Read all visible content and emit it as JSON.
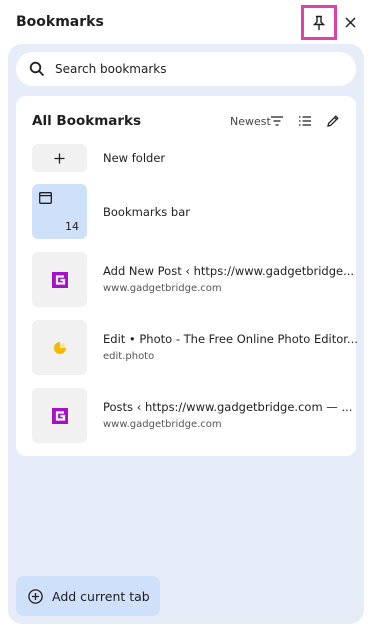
{
  "header": {
    "title": "Bookmarks"
  },
  "search": {
    "placeholder": "Search bookmarks"
  },
  "list": {
    "title": "All Bookmarks",
    "sort_label": "Newest"
  },
  "rows": {
    "new_folder": {
      "title": "New folder"
    },
    "bookmarks_bar": {
      "title": "Bookmarks bar",
      "count": "14"
    },
    "item1": {
      "title": "Add New Post ‹ https://www.gadgetbridge...",
      "url": "www.gadgetbridge.com",
      "icon": "gadgetbridge-favicon"
    },
    "item2": {
      "title": "Edit • Photo - The Free Online Photo Editor...",
      "url": "edit.photo",
      "icon": "edit-photo-favicon"
    },
    "item3": {
      "title": "Posts ‹ https://www.gadgetbridge.com — ...",
      "url": "www.gadgetbridge.com",
      "icon": "gadgetbridge-favicon"
    }
  },
  "footer": {
    "add_label": "Add current tab"
  },
  "colors": {
    "highlight": "#e040a8",
    "panel": "#e7edf8",
    "accent": "#cfe0fb",
    "gb_brand": "#a511c9",
    "photo_brand": "#f9b800"
  }
}
